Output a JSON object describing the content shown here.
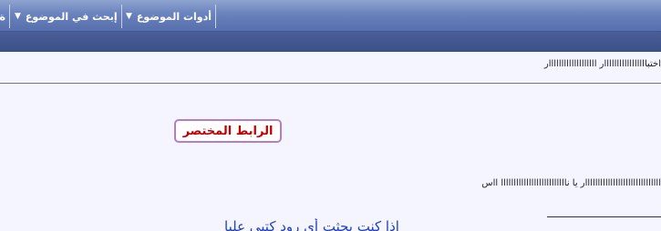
{
  "toolbar": {
    "items": [
      {
        "label": "أدوات الموضوع",
        "arrow": "▼"
      },
      {
        "label": "إبحث في الموضوع",
        "arrow": "▼"
      }
    ],
    "edge_label": "ة"
  },
  "post": {
    "line1": "اختبااااااااااااااااار ااااااااااااااااااار",
    "shortlink_label": "الرابط المختصر",
    "line2": "اااااااااااااااااااااااااااااار يا ناااااااااااااااااااااااااا ااس",
    "line3": "اذا كنت بحثت أي رود كتبي عليا"
  }
}
